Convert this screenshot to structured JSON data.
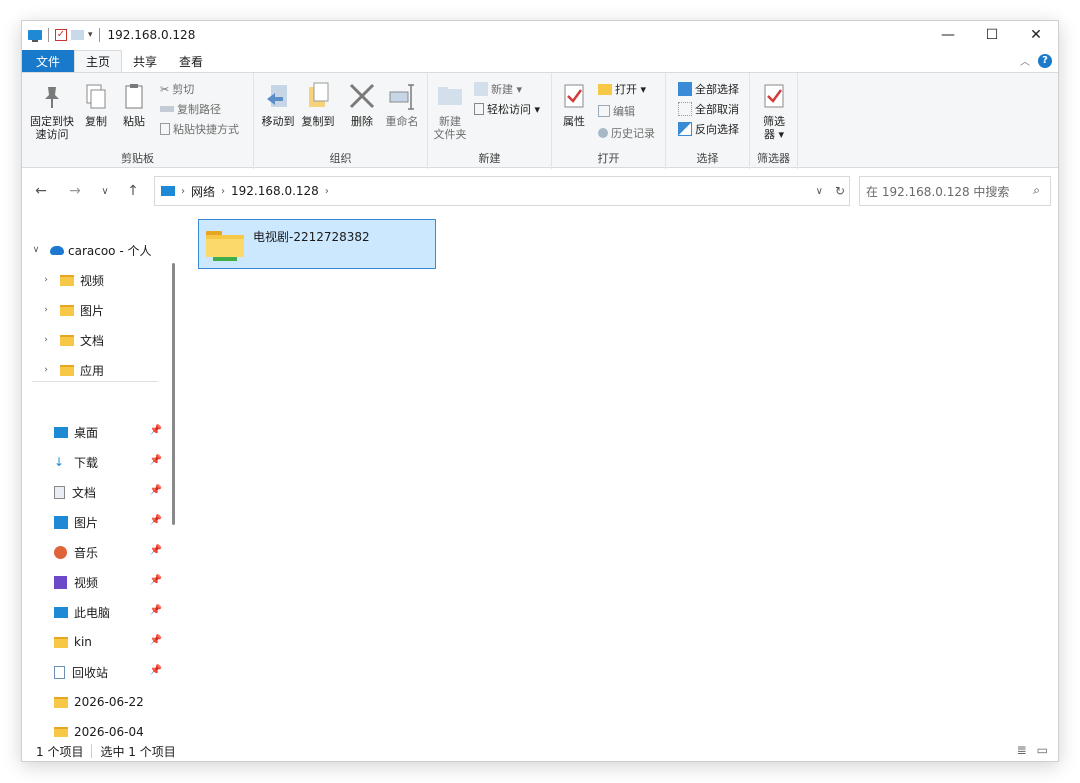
{
  "window": {
    "title": "192.168.0.128"
  },
  "window_controls": {
    "minimize": "—",
    "maximize": "☐",
    "close": "✕"
  },
  "tabs": [
    {
      "label": "文件"
    },
    {
      "label": "主页"
    },
    {
      "label": "共享"
    },
    {
      "label": "查看"
    }
  ],
  "ribbon": {
    "clipboard": {
      "label": "剪贴板",
      "pin_quick_access": "固定到快\n速访问",
      "copy": "复制",
      "paste": "粘贴",
      "cut": "剪切",
      "copy_path": "复制路径",
      "paste_shortcut": "粘贴快捷方式"
    },
    "organize": {
      "label": "组织",
      "move_to": "移动到",
      "copy_to": "复制到",
      "delete": "删除",
      "rename": "重命名"
    },
    "new": {
      "label": "新建",
      "new_folder": "新建\n文件夹",
      "new_item": "新建 ▾",
      "easy_access": "轻松访问 ▾"
    },
    "open": {
      "label": "打开",
      "properties": "属性",
      "open": "打开 ▾",
      "edit": "编辑",
      "history": "历史记录"
    },
    "select": {
      "label": "选择",
      "select_all": "全部选择",
      "select_none": "全部取消",
      "invert": "反向选择"
    },
    "filter": {
      "label": "筛选器",
      "filter_btn": "筛选\n器 ▾"
    }
  },
  "address": {
    "crumbs": [
      "网络",
      "192.168.0.128"
    ],
    "search_placeholder": "在 192.168.0.128 中搜索"
  },
  "sidebar": {
    "onedrive": "caracoo - 个人",
    "onedrive_children": [
      "视频",
      "图片",
      "文档",
      "应用"
    ],
    "quick_access": [
      {
        "label": "桌面"
      },
      {
        "label": "下载"
      },
      {
        "label": "文档"
      },
      {
        "label": "图片"
      },
      {
        "label": "音乐"
      },
      {
        "label": "视频"
      },
      {
        "label": "此电脑"
      },
      {
        "label": "kin"
      },
      {
        "label": "回收站"
      },
      {
        "label": "2026-06-22"
      },
      {
        "label": "2026-06-04"
      }
    ]
  },
  "content": {
    "items": [
      {
        "name": "电视剧-2212728382",
        "selected": true
      }
    ]
  },
  "status": {
    "count": "1 个项目",
    "selected": "选中 1 个项目"
  },
  "colors": {
    "accent": "#1979ca",
    "selection_fill": "#cce8ff",
    "selection_border": "#3a8bd6",
    "folder_yellow": "#f7c846"
  }
}
